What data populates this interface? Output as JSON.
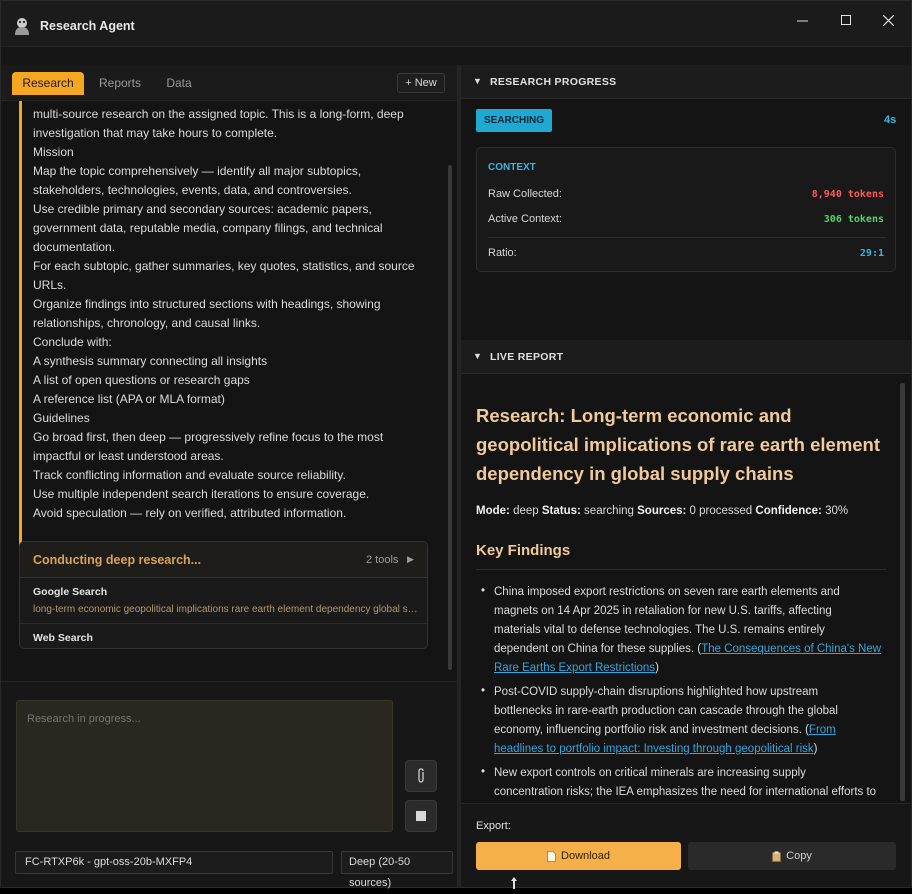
{
  "app": {
    "title": "Research Agent"
  },
  "tabs": [
    {
      "label": "Research"
    },
    {
      "label": "Reports"
    },
    {
      "label": "Data"
    }
  ],
  "new_button": "+ New",
  "message_lines": [
    "multi-source research on the assigned topic. This is a long-form, deep",
    "investigation that may take hours to complete.",
    "Mission",
    "Map the topic comprehensively — identify all major subtopics,",
    "stakeholders, technologies, events, data, and controversies.",
    "Use credible primary and secondary sources: academic papers,",
    "government data, reputable media, company filings, and technical",
    "documentation.",
    "For each subtopic, gather summaries, key quotes, statistics, and source",
    "URLs.",
    "Organize findings into structured sections with headings, showing",
    "relationships, chronology, and causal links.",
    "Conclude with:",
    "A synthesis summary connecting all insights",
    "A list of open questions or research gaps",
    "A reference list (APA or MLA format)",
    "Guidelines",
    "Go broad first, then deep — progressively refine focus to the most",
    "impactful or least understood areas.",
    "Track conflicting information and evaluate source reliability.",
    "Use multiple independent search iterations to ensure coverage.",
    "Avoid speculation — rely on verified, attributed information."
  ],
  "tools_card": {
    "title": "Conducting deep research...",
    "count": "2 tools",
    "items": [
      {
        "name": "Google Search",
        "query": "long-term economic geopolitical implications rare earth element dependency global supply chains"
      },
      {
        "name": "Web Search",
        "query": ""
      }
    ]
  },
  "composer": {
    "placeholder": "Research in progress...",
    "model": "FC-RTXP6k - gpt-oss-20b-MXFP4",
    "depth": "Deep (20-50 sources)"
  },
  "progress": {
    "header": "RESEARCH PROGRESS",
    "status": "SEARCHING",
    "elapsed": "4s",
    "context": {
      "title": "CONTEXT",
      "raw_label": "Raw Collected:",
      "raw_value": "8,940 tokens",
      "active_label": "Active Context:",
      "active_value": "306 tokens",
      "ratio_label": "Ratio:",
      "ratio_value": "29:1"
    }
  },
  "report": {
    "header": "LIVE REPORT",
    "title": "Research: Long-term economic and geopolitical implications of rare earth element dependency in global supply chains",
    "meta": {
      "mode_label": "Mode:",
      "mode": "deep",
      "status_label": "Status:",
      "status": "searching",
      "sources_label": "Sources:",
      "sources": "0 processed",
      "confidence_label": "Confidence:",
      "confidence": "30%"
    },
    "findings_heading": "Key Findings",
    "finding1": {
      "l1": "China imposed export restrictions on seven rare earth elements and",
      "l2": "magnets on 14 Apr 2025 in retaliation for new U.S. tariffs, affecting",
      "l3": "materials vital to defense technologies. The U.S. remains entirely",
      "l4_pre": "dependent on China for these supplies. (",
      "l4_link": "The Consequences of China's New",
      "l5_link": "Rare Earths Export Restrictions",
      "l5_post": ")"
    },
    "finding2": {
      "l1": "Post-COVID supply-chain disruptions highlighted how upstream",
      "l2": "bottlenecks in rare-earth production can cascade through the global",
      "l3_pre": "economy, influencing portfolio risk and investment decisions. (",
      "l3_link": "From",
      "l4_link": "headlines to portfolio impact: Investing through geopolitical risk",
      "l4_post": ")"
    },
    "finding3": {
      "l1": "New export controls on critical minerals are increasing supply",
      "l2": "concentration risks; the IEA emphasizes the need for international efforts to"
    }
  },
  "export": {
    "label": "Export:",
    "download": "Download",
    "copy": "Copy"
  },
  "colors": {
    "accent": "#f5a623",
    "info": "#1ea8d4",
    "raw_tokens": "#ff5a5a",
    "active_tokens": "#4cd964"
  }
}
